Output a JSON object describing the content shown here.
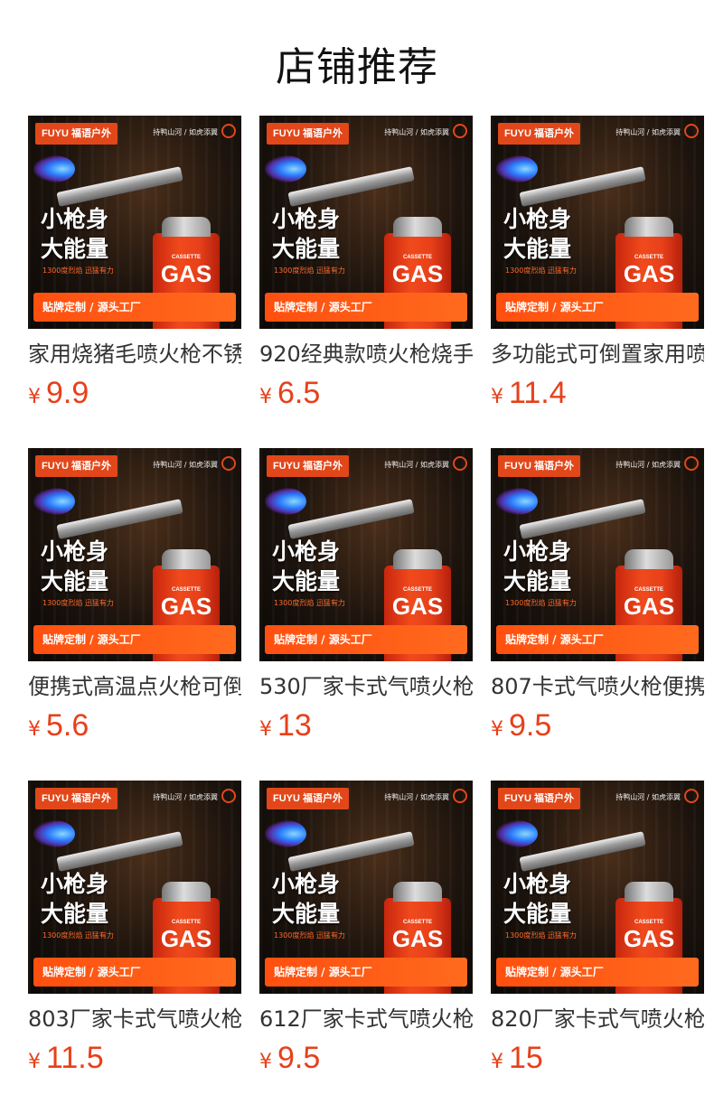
{
  "header": {
    "title": "店铺推荐"
  },
  "colors": {
    "accent": "#e8401a",
    "brand": "#e2471a"
  },
  "banner": {
    "brand": "FUYU 福语户外",
    "slogan": "持鸭山河 / 如虎添翼",
    "headline_line1": "小枪身",
    "headline_line2": "大能量",
    "subline": "1300度烈焰 迅猛有力",
    "bottom_bar": "贴牌定制 / 源头工厂",
    "can_small": "CASSETTE",
    "can_big": "GAS"
  },
  "currency_symbol": "¥",
  "products": [
    {
      "name": "家用烧猪毛喷火枪不锈",
      "price": "9.9",
      "flame_icon": "flame-icon"
    },
    {
      "name": "920经典款喷火枪烧手",
      "price": "6.5",
      "flame_icon": "flame-icon"
    },
    {
      "name": "多功能式可倒置家用喷",
      "price": "11.4",
      "flame_icon": "flame-icon"
    },
    {
      "name": "便携式高温点火枪可倒",
      "price": "5.6",
      "flame_icon": "flame-icon"
    },
    {
      "name": "530厂家卡式气喷火枪",
      "price": "13",
      "flame_icon": "flame-icon"
    },
    {
      "name": "807卡式气喷火枪便携",
      "price": "9.5",
      "flame_icon": "flame-icon"
    },
    {
      "name": "803厂家卡式气喷火枪",
      "price": "11.5",
      "flame_icon": "flame-icon"
    },
    {
      "name": "612厂家卡式气喷火枪",
      "price": "9.5",
      "flame_icon": "flame-icon"
    },
    {
      "name": "820厂家卡式气喷火枪",
      "price": "15",
      "flame_icon": "flame-icon"
    }
  ]
}
